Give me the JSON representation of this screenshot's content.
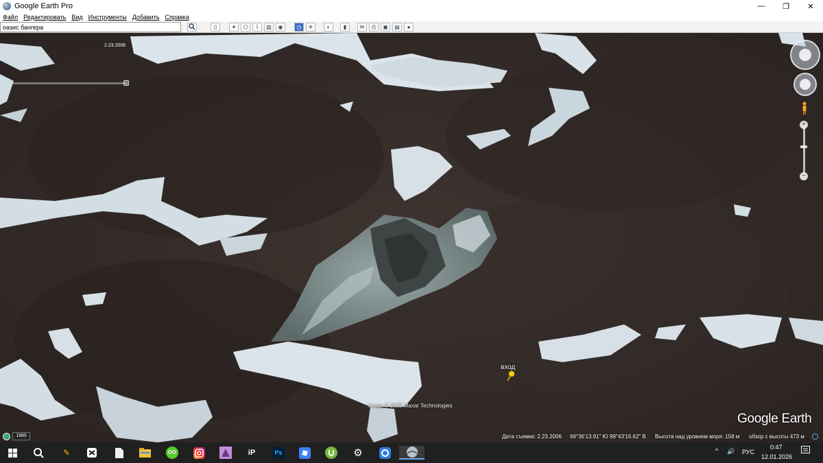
{
  "window": {
    "title": "Google Earth Pro",
    "controls": [
      "—",
      "❐",
      "✕"
    ]
  },
  "menu": {
    "items": [
      "Файл",
      "Редактировать",
      "Вид",
      "Инструменты",
      "Добавить",
      "Справка"
    ]
  },
  "search": {
    "value": "оазис бангера",
    "button_icon": "search-icon"
  },
  "toolbar": {
    "icons": [
      "sidebar-toggle-icon",
      "placemark-icon",
      "polygon-icon",
      "path-icon",
      "image-overlay-icon",
      "tour-icon",
      "historical-imagery-icon",
      "sun-icon",
      "planets-icon",
      "ruler-icon",
      "email-icon",
      "print-icon",
      "save-image-icon",
      "maps-icon",
      "earth-icon"
    ]
  },
  "map": {
    "history_date": "2.23.2006",
    "placemark_label": "вход",
    "imagery_credit": "Image © 2025 Maxar Technologies",
    "brand": "Google Earth"
  },
  "status": {
    "year": "1985",
    "capture_date": "Дата съемки: 2.23.2006",
    "coordinates": "66°36'13.91\" Ю   99°43'16.62\" В",
    "elevation": "Высота над уровнем моря:   158 м",
    "eye_alt": "обзор с высоты    473 м"
  },
  "taskbar": {
    "apps": [
      "start-icon",
      "search-icon",
      "cleaner-icon",
      "capcut-icon",
      "file-icon",
      "explorer-icon",
      "duo-icon",
      "instagram-icon",
      "game-icon",
      "ip-icon",
      "photoshop-icon",
      "roblox-icon",
      "utorrent-icon",
      "settings-icon",
      "launcher-icon",
      "google-earth-icon"
    ],
    "photoshop_label": "Ps",
    "tray_chevron": "^",
    "tray_volume": "🔊",
    "language": "РУС",
    "time": "0:47",
    "date": "12.01.2026"
  }
}
